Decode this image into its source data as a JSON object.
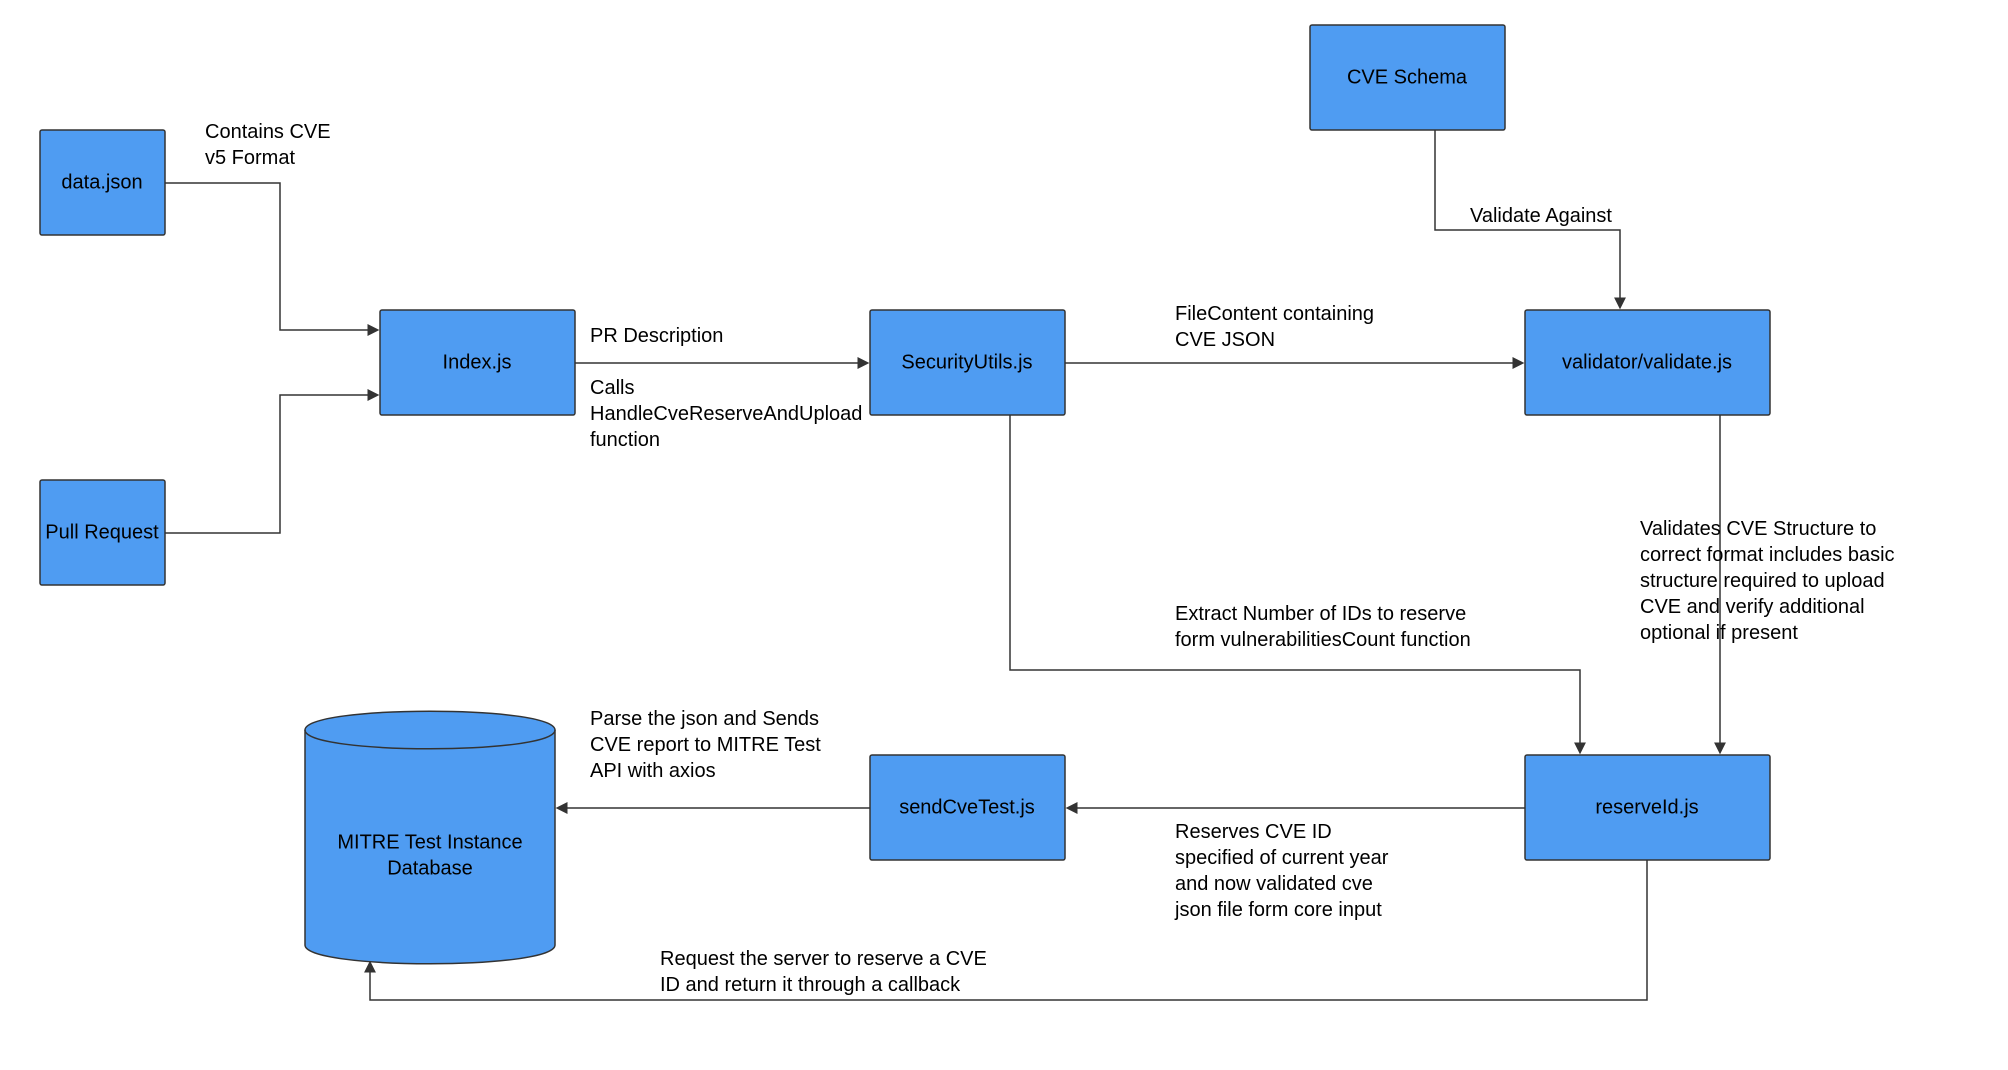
{
  "nodes": {
    "data_json": "data.json",
    "pull_request": "Pull Request",
    "index_js": "Index.js",
    "security_utils": "SecurityUtils.js",
    "validator": "validator/validate.js",
    "cve_schema": "CVE Schema",
    "reserve_id": "reserveId.js",
    "send_cve_test": "sendCveTest.js",
    "mitre_db_l1": "MITRE Test Instance",
    "mitre_db_l2": "Database"
  },
  "edges": {
    "data_json_l1": "Contains CVE",
    "data_json_l2": "v5 Format",
    "index_top": "PR Description",
    "index_bot_l1": "Calls",
    "index_bot_l2": "HandleCveReserveAndUpload",
    "index_bot_l3": "function",
    "sec_to_val_l1": "FileContent containing",
    "sec_to_val_l2": "CVE JSON",
    "schema_to_val": "Validate Against",
    "val_down_l1": "Validates CVE Structure to",
    "val_down_l2": "correct format includes basic",
    "val_down_l3": "structure required to upload",
    "val_down_l4": "CVE and verify additional",
    "val_down_l5": "optional if present",
    "sec_to_res_l1": "Extract Number of IDs to reserve",
    "sec_to_res_l2": "form vulnerabilitiesCount function",
    "res_to_send_l1": "Reserves CVE ID",
    "res_to_send_l2": "specified of current year",
    "res_to_send_l3": "and now validated cve",
    "res_to_send_l4": "json file form core input",
    "send_to_db_l1": "Parse the json and Sends",
    "send_to_db_l2": "CVE report to MITRE Test",
    "send_to_db_l3": "API with axios",
    "res_to_db_l1": "Request the server to reserve a CVE",
    "res_to_db_l2": "ID and return it through a callback"
  }
}
